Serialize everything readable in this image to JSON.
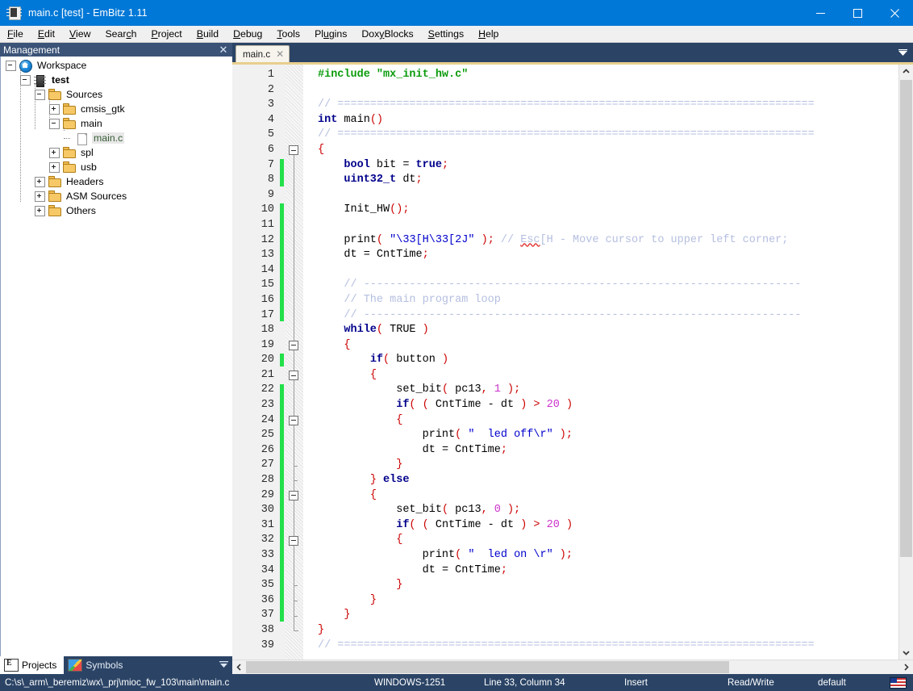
{
  "window": {
    "title": "main.c [test] - EmBitz 1.11",
    "icon": "embitz-chip-icon",
    "minimize": "minimize-icon",
    "maximize": "maximize-icon",
    "close": "close-icon"
  },
  "menubar": {
    "items": [
      {
        "label": "File",
        "accel": "F"
      },
      {
        "label": "Edit",
        "accel": "E"
      },
      {
        "label": "View",
        "accel": "V"
      },
      {
        "label": "Search",
        "accel": "c"
      },
      {
        "label": "Project",
        "accel": "P"
      },
      {
        "label": "Build",
        "accel": "B"
      },
      {
        "label": "Debug",
        "accel": "D"
      },
      {
        "label": "Tools",
        "accel": "T"
      },
      {
        "label": "Plugins",
        "accel": "u"
      },
      {
        "label": "DoxyBlocks",
        "accel": "y"
      },
      {
        "label": "Settings",
        "accel": "S"
      },
      {
        "label": "Help",
        "accel": "H"
      }
    ]
  },
  "management": {
    "header_title": "Management",
    "close_label": "✕",
    "tree": [
      {
        "label": "Workspace",
        "depth": 0,
        "toggle": "minus",
        "icon": "workspace-icon",
        "selected": false,
        "bold": false
      },
      {
        "label": "test",
        "depth": 1,
        "toggle": "minus",
        "icon": "project-chip-icon",
        "selected": false,
        "bold": true
      },
      {
        "label": "Sources",
        "depth": 2,
        "toggle": "minus",
        "icon": "folder-icon",
        "selected": false,
        "bold": false
      },
      {
        "label": "cmsis_gtk",
        "depth": 3,
        "toggle": "plus",
        "icon": "folder-icon",
        "selected": false,
        "bold": false
      },
      {
        "label": "main",
        "depth": 3,
        "toggle": "minus",
        "icon": "folder-icon",
        "selected": false,
        "bold": false
      },
      {
        "label": "main.c",
        "depth": 4,
        "toggle": "none",
        "icon": "file-icon",
        "selected": true,
        "bold": false
      },
      {
        "label": "spl",
        "depth": 3,
        "toggle": "plus",
        "icon": "folder-icon",
        "selected": false,
        "bold": false
      },
      {
        "label": "usb",
        "depth": 3,
        "toggle": "plus",
        "icon": "folder-icon",
        "selected": false,
        "bold": false
      },
      {
        "label": "Headers",
        "depth": 2,
        "toggle": "plus",
        "icon": "folder-icon",
        "selected": false,
        "bold": false
      },
      {
        "label": "ASM Sources",
        "depth": 2,
        "toggle": "plus",
        "icon": "folder-icon",
        "selected": false,
        "bold": false
      },
      {
        "label": "Others",
        "depth": 2,
        "toggle": "plus",
        "icon": "folder-icon",
        "selected": false,
        "bold": false
      }
    ],
    "bottom_tabs": [
      {
        "label": "Projects",
        "icon": "projects-icon",
        "active": true
      },
      {
        "label": "Symbols",
        "icon": "symbols-icon",
        "active": false
      }
    ],
    "bottom_tabs_menu": "chevron-down-icon"
  },
  "editor": {
    "tabs": [
      {
        "label": "main.c",
        "close": "✕",
        "active": true
      }
    ],
    "tab_dropdown": "chevron-down-icon",
    "first_line": 1,
    "last_line": 39,
    "lines": [
      {
        "n": 1,
        "tokens": [
          {
            "t": "#include ",
            "c": "pre"
          },
          {
            "t": "\"mx_init_hw.c\"",
            "c": "pre"
          }
        ]
      },
      {
        "n": 2,
        "tokens": []
      },
      {
        "n": 3,
        "tokens": [
          {
            "t": "// =========================================================================",
            "c": "cmt"
          }
        ]
      },
      {
        "n": 4,
        "tokens": [
          {
            "t": "int",
            "c": "kw"
          },
          {
            "t": " main",
            "c": "plain"
          },
          {
            "t": "()",
            "c": "pun"
          }
        ]
      },
      {
        "n": 5,
        "tokens": [
          {
            "t": "// =========================================================================",
            "c": "cmt"
          }
        ]
      },
      {
        "n": 6,
        "tokens": [
          {
            "t": "{",
            "c": "pun"
          }
        ]
      },
      {
        "n": 7,
        "tokens": [
          {
            "t": "    ",
            "c": "plain"
          },
          {
            "t": "bool",
            "c": "ty"
          },
          {
            "t": " bit ",
            "c": "plain"
          },
          {
            "t": "=",
            "c": "plain"
          },
          {
            "t": " ",
            "c": "plain"
          },
          {
            "t": "true",
            "c": "kw"
          },
          {
            "t": ";",
            "c": "pun"
          }
        ]
      },
      {
        "n": 8,
        "tokens": [
          {
            "t": "    ",
            "c": "plain"
          },
          {
            "t": "uint32_t",
            "c": "ty"
          },
          {
            "t": " dt",
            "c": "plain"
          },
          {
            "t": ";",
            "c": "pun"
          }
        ]
      },
      {
        "n": 9,
        "tokens": []
      },
      {
        "n": 10,
        "tokens": [
          {
            "t": "    Init_HW",
            "c": "plain"
          },
          {
            "t": "()",
            "c": "pun"
          },
          {
            "t": ";",
            "c": "pun"
          }
        ]
      },
      {
        "n": 11,
        "tokens": []
      },
      {
        "n": 12,
        "tokens": [
          {
            "t": "    print",
            "c": "plain"
          },
          {
            "t": "(",
            "c": "pun"
          },
          {
            "t": " ",
            "c": "plain"
          },
          {
            "t": "\"\\33[H\\33[2J\"",
            "c": "str"
          },
          {
            "t": " ",
            "c": "plain"
          },
          {
            "t": ")",
            "c": "pun"
          },
          {
            "t": ";",
            "c": "pun"
          },
          {
            "t": " ",
            "c": "plain"
          },
          {
            "t": "// ",
            "c": "cmt"
          },
          {
            "t": "Esc",
            "c": "cmt sq"
          },
          {
            "t": "[H - Move cursor to upper left corner;",
            "c": "cmt"
          }
        ]
      },
      {
        "n": 13,
        "tokens": [
          {
            "t": "    dt ",
            "c": "plain"
          },
          {
            "t": "=",
            "c": "plain"
          },
          {
            "t": " CntTime",
            "c": "plain"
          },
          {
            "t": ";",
            "c": "pun"
          }
        ]
      },
      {
        "n": 14,
        "tokens": []
      },
      {
        "n": 15,
        "tokens": [
          {
            "t": "    // -------------------------------------------------------------------",
            "c": "cmt"
          }
        ]
      },
      {
        "n": 16,
        "tokens": [
          {
            "t": "    // The main program loop",
            "c": "cmt"
          }
        ]
      },
      {
        "n": 17,
        "tokens": [
          {
            "t": "    // -------------------------------------------------------------------",
            "c": "cmt"
          }
        ]
      },
      {
        "n": 18,
        "tokens": [
          {
            "t": "    ",
            "c": "plain"
          },
          {
            "t": "while",
            "c": "kw"
          },
          {
            "t": "(",
            "c": "pun"
          },
          {
            "t": " TRUE ",
            "c": "plain"
          },
          {
            "t": ")",
            "c": "pun"
          }
        ]
      },
      {
        "n": 19,
        "tokens": [
          {
            "t": "    ",
            "c": "plain"
          },
          {
            "t": "{",
            "c": "pun"
          }
        ]
      },
      {
        "n": 20,
        "tokens": [
          {
            "t": "        ",
            "c": "plain"
          },
          {
            "t": "if",
            "c": "kw"
          },
          {
            "t": "(",
            "c": "pun"
          },
          {
            "t": " button ",
            "c": "plain"
          },
          {
            "t": ")",
            "c": "pun"
          }
        ]
      },
      {
        "n": 21,
        "tokens": [
          {
            "t": "        ",
            "c": "plain"
          },
          {
            "t": "{",
            "c": "pun"
          }
        ]
      },
      {
        "n": 22,
        "tokens": [
          {
            "t": "            set_bit",
            "c": "plain"
          },
          {
            "t": "(",
            "c": "pun"
          },
          {
            "t": " pc13",
            "c": "plain"
          },
          {
            "t": ",",
            "c": "pun"
          },
          {
            "t": " ",
            "c": "plain"
          },
          {
            "t": "1",
            "c": "num"
          },
          {
            "t": " ",
            "c": "plain"
          },
          {
            "t": ")",
            "c": "pun"
          },
          {
            "t": ";",
            "c": "pun"
          }
        ]
      },
      {
        "n": 23,
        "tokens": [
          {
            "t": "            ",
            "c": "plain"
          },
          {
            "t": "if",
            "c": "kw"
          },
          {
            "t": "(",
            "c": "pun"
          },
          {
            "t": " ",
            "c": "plain"
          },
          {
            "t": "(",
            "c": "pun"
          },
          {
            "t": " CntTime ",
            "c": "plain"
          },
          {
            "t": "-",
            "c": "plain"
          },
          {
            "t": " dt ",
            "c": "plain"
          },
          {
            "t": ")",
            "c": "pun"
          },
          {
            "t": " ",
            "c": "plain"
          },
          {
            "t": ">",
            "c": "op"
          },
          {
            "t": " ",
            "c": "plain"
          },
          {
            "t": "20",
            "c": "num"
          },
          {
            "t": " ",
            "c": "plain"
          },
          {
            "t": ")",
            "c": "pun"
          }
        ]
      },
      {
        "n": 24,
        "tokens": [
          {
            "t": "            ",
            "c": "plain"
          },
          {
            "t": "{",
            "c": "pun"
          }
        ]
      },
      {
        "n": 25,
        "tokens": [
          {
            "t": "                print",
            "c": "plain"
          },
          {
            "t": "(",
            "c": "pun"
          },
          {
            "t": " ",
            "c": "plain"
          },
          {
            "t": "\"  led off\\r\"",
            "c": "str"
          },
          {
            "t": " ",
            "c": "plain"
          },
          {
            "t": ")",
            "c": "pun"
          },
          {
            "t": ";",
            "c": "pun"
          }
        ]
      },
      {
        "n": 26,
        "tokens": [
          {
            "t": "                dt ",
            "c": "plain"
          },
          {
            "t": "=",
            "c": "plain"
          },
          {
            "t": " CntTime",
            "c": "plain"
          },
          {
            "t": ";",
            "c": "pun"
          }
        ]
      },
      {
        "n": 27,
        "tokens": [
          {
            "t": "            ",
            "c": "plain"
          },
          {
            "t": "}",
            "c": "pun"
          }
        ]
      },
      {
        "n": 28,
        "tokens": [
          {
            "t": "        ",
            "c": "plain"
          },
          {
            "t": "}",
            "c": "pun"
          },
          {
            "t": " ",
            "c": "plain"
          },
          {
            "t": "else",
            "c": "kw"
          }
        ]
      },
      {
        "n": 29,
        "tokens": [
          {
            "t": "        ",
            "c": "plain"
          },
          {
            "t": "{",
            "c": "pun"
          }
        ]
      },
      {
        "n": 30,
        "tokens": [
          {
            "t": "            set_bit",
            "c": "plain"
          },
          {
            "t": "(",
            "c": "pun"
          },
          {
            "t": " pc13",
            "c": "plain"
          },
          {
            "t": ",",
            "c": "pun"
          },
          {
            "t": " ",
            "c": "plain"
          },
          {
            "t": "0",
            "c": "num"
          },
          {
            "t": " ",
            "c": "plain"
          },
          {
            "t": ")",
            "c": "pun"
          },
          {
            "t": ";",
            "c": "pun"
          }
        ]
      },
      {
        "n": 31,
        "tokens": [
          {
            "t": "            ",
            "c": "plain"
          },
          {
            "t": "if",
            "c": "kw"
          },
          {
            "t": "(",
            "c": "pun"
          },
          {
            "t": " ",
            "c": "plain"
          },
          {
            "t": "(",
            "c": "pun"
          },
          {
            "t": " CntTime ",
            "c": "plain"
          },
          {
            "t": "-",
            "c": "plain"
          },
          {
            "t": " dt ",
            "c": "plain"
          },
          {
            "t": ")",
            "c": "pun"
          },
          {
            "t": " ",
            "c": "plain"
          },
          {
            "t": ">",
            "c": "op"
          },
          {
            "t": " ",
            "c": "plain"
          },
          {
            "t": "20",
            "c": "num"
          },
          {
            "t": " ",
            "c": "plain"
          },
          {
            "t": ")",
            "c": "pun"
          }
        ]
      },
      {
        "n": 32,
        "tokens": [
          {
            "t": "            ",
            "c": "plain"
          },
          {
            "t": "{",
            "c": "pun"
          }
        ]
      },
      {
        "n": 33,
        "tokens": [
          {
            "t": "                print",
            "c": "plain"
          },
          {
            "t": "(",
            "c": "pun"
          },
          {
            "t": " ",
            "c": "plain"
          },
          {
            "t": "\"  led on \\r\"",
            "c": "str"
          },
          {
            "t": " ",
            "c": "plain"
          },
          {
            "t": ")",
            "c": "pun"
          },
          {
            "t": ";",
            "c": "pun"
          }
        ]
      },
      {
        "n": 34,
        "tokens": [
          {
            "t": "                dt ",
            "c": "plain"
          },
          {
            "t": "=",
            "c": "plain"
          },
          {
            "t": " CntTime",
            "c": "plain"
          },
          {
            "t": ";",
            "c": "pun"
          }
        ]
      },
      {
        "n": 35,
        "tokens": [
          {
            "t": "            ",
            "c": "plain"
          },
          {
            "t": "}",
            "c": "pun"
          }
        ]
      },
      {
        "n": 36,
        "tokens": [
          {
            "t": "        ",
            "c": "plain"
          },
          {
            "t": "}",
            "c": "pun"
          }
        ]
      },
      {
        "n": 37,
        "tokens": [
          {
            "t": "    ",
            "c": "plain"
          },
          {
            "t": "}",
            "c": "pun"
          }
        ]
      },
      {
        "n": 38,
        "tokens": [
          {
            "t": "}",
            "c": "pun"
          }
        ]
      },
      {
        "n": 39,
        "tokens": [
          {
            "t": "// =========================================================================",
            "c": "cmt"
          }
        ]
      }
    ],
    "change_bars": [
      {
        "from": 7,
        "to": 8
      },
      {
        "from": 10,
        "to": 17
      },
      {
        "from": 20,
        "to": 20
      },
      {
        "from": 22,
        "to": 37
      }
    ],
    "fold_markers": [
      {
        "line": 6,
        "type": "box"
      },
      {
        "line": 19,
        "type": "box"
      },
      {
        "line": 21,
        "type": "box"
      },
      {
        "line": 24,
        "type": "box"
      },
      {
        "line": 27,
        "type": "tick"
      },
      {
        "line": 28,
        "type": "tick"
      },
      {
        "line": 29,
        "type": "box"
      },
      {
        "line": 32,
        "type": "box"
      },
      {
        "line": 35,
        "type": "tick"
      },
      {
        "line": 36,
        "type": "tick"
      },
      {
        "line": 37,
        "type": "tick"
      },
      {
        "line": 38,
        "type": "end"
      }
    ],
    "scroll": {
      "v_up": "scroll-up-icon",
      "v_down": "scroll-down-icon",
      "h_left": "scroll-left-icon",
      "h_right": "scroll-right-icon"
    }
  },
  "statusbar": {
    "path": "C:\\s\\_arm\\_beremiz\\wx\\_prj\\mioc_fw_103\\main\\main.c",
    "encoding": "WINDOWS-1251",
    "caret": "Line 33, Column 34",
    "insert_mode": "Insert",
    "access": "Read/Write",
    "profile": "default",
    "locale_icon": "us-flag-icon"
  },
  "colors": {
    "title_bar": "#0078d7",
    "chrome": "#2b4466",
    "panel_header": "#3b5377",
    "editor_bg": "#ffffff",
    "gutter_bg": "#f1f1f1",
    "change_bar": "#22e04a",
    "tab_active": "#f7f4ee",
    "tab_underline": "#e8cf8e",
    "keyword": "#00008b",
    "string": "#0000cd",
    "comment": "#b5bfe0",
    "number": "#cc33cc",
    "punctuation": "#cc0000",
    "preprocessor": "#0a9b0a",
    "selection": "#e8e8e8"
  }
}
